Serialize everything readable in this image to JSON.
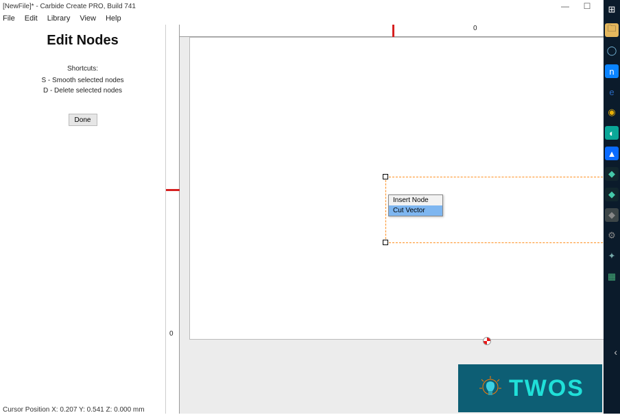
{
  "window": {
    "title": "[NewFile]* - Carbide Create PRO, Build 741",
    "minimize": "—",
    "maximize": "☐",
    "close": "✕"
  },
  "menu": [
    "File",
    "Edit",
    "Library",
    "View",
    "Help"
  ],
  "panel": {
    "title": "Edit Nodes",
    "shortcuts_title": "Shortcuts:",
    "shortcut_s": "S - Smooth selected nodes",
    "shortcut_d": "D - Delete selected nodes",
    "done": "Done"
  },
  "ruler": {
    "h_label": "0",
    "v_label": "0"
  },
  "context_menu": {
    "insert_node": "Insert Node",
    "cut_vector": "Cut Vector"
  },
  "status": "Cursor Position X:  0.207 Y:  0.541 Z:  0.000 mm",
  "watermark": {
    "text": "TWOS"
  },
  "taskbar_icons": [
    {
      "name": "windows-start-icon",
      "bg": "transparent",
      "glyph": "⊞",
      "color": "#fff"
    },
    {
      "name": "file-explorer-icon",
      "bg": "#e4b75d",
      "glyph": "🗀",
      "color": "#333"
    },
    {
      "name": "cortana-icon",
      "bg": "transparent",
      "glyph": "◯",
      "color": "#7ec2e6"
    },
    {
      "name": "nordvpn-icon",
      "bg": "#0a84ff",
      "glyph": "n",
      "color": "#fff"
    },
    {
      "name": "edge-icon",
      "bg": "transparent",
      "glyph": "e",
      "color": "#2a6bc4"
    },
    {
      "name": "chrome-icon",
      "bg": "transparent",
      "glyph": "◉",
      "color": "#eab106"
    },
    {
      "name": "teal-app-icon",
      "bg": "#0aa798",
      "glyph": "◐",
      "color": "#fff"
    },
    {
      "name": "blue-app-icon",
      "bg": "#0a6bff",
      "glyph": "▲",
      "color": "#fff"
    },
    {
      "name": "carbide-icon-1",
      "bg": "#12262d",
      "glyph": "◆",
      "color": "#45c9aa"
    },
    {
      "name": "carbide-icon-2",
      "bg": "#12262d",
      "glyph": "◆",
      "color": "#45c9aa"
    },
    {
      "name": "carbide-icon-3",
      "bg": "#3d4648",
      "glyph": "◆",
      "color": "#888"
    },
    {
      "name": "settings-icon",
      "bg": "transparent",
      "glyph": "⚙",
      "color": "#888"
    },
    {
      "name": "app-icon-a",
      "bg": "transparent",
      "glyph": "✦",
      "color": "#7aa"
    },
    {
      "name": "app-icon-b",
      "bg": "transparent",
      "glyph": "▦",
      "color": "#4a7"
    }
  ]
}
